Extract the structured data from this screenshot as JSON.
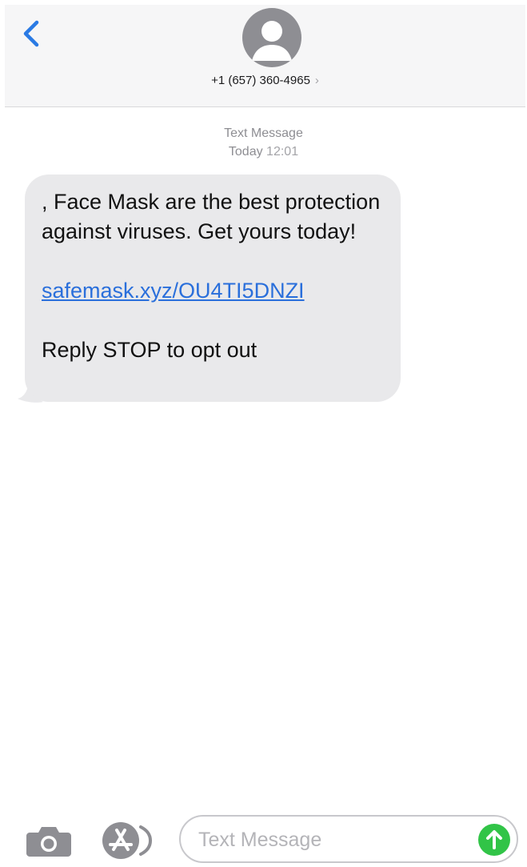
{
  "header": {
    "contact": "+1 (657) 360-4965",
    "contact_chevron": "›",
    "avatar_icon": "person-silhouette-icon",
    "back_icon": "chevron-left-icon"
  },
  "thread": {
    "service_label": "Text Message",
    "day_label": "Today",
    "time_label": "12:01"
  },
  "message": {
    "body": ", Face Mask are the best protection against viruses. Get yours today!",
    "link": "safemask.xyz/OU4TI5DNZI",
    "footer": "Reply STOP to opt out"
  },
  "composer": {
    "placeholder": "Text Message",
    "camera_icon": "camera-icon",
    "apps_icon": "app-store-icon",
    "send_icon": "arrow-up-icon"
  },
  "colors": {
    "accent": "#2a6fdb",
    "bubble": "#e9e9eb",
    "send": "#31c447",
    "header_bg": "#f6f6f7"
  }
}
